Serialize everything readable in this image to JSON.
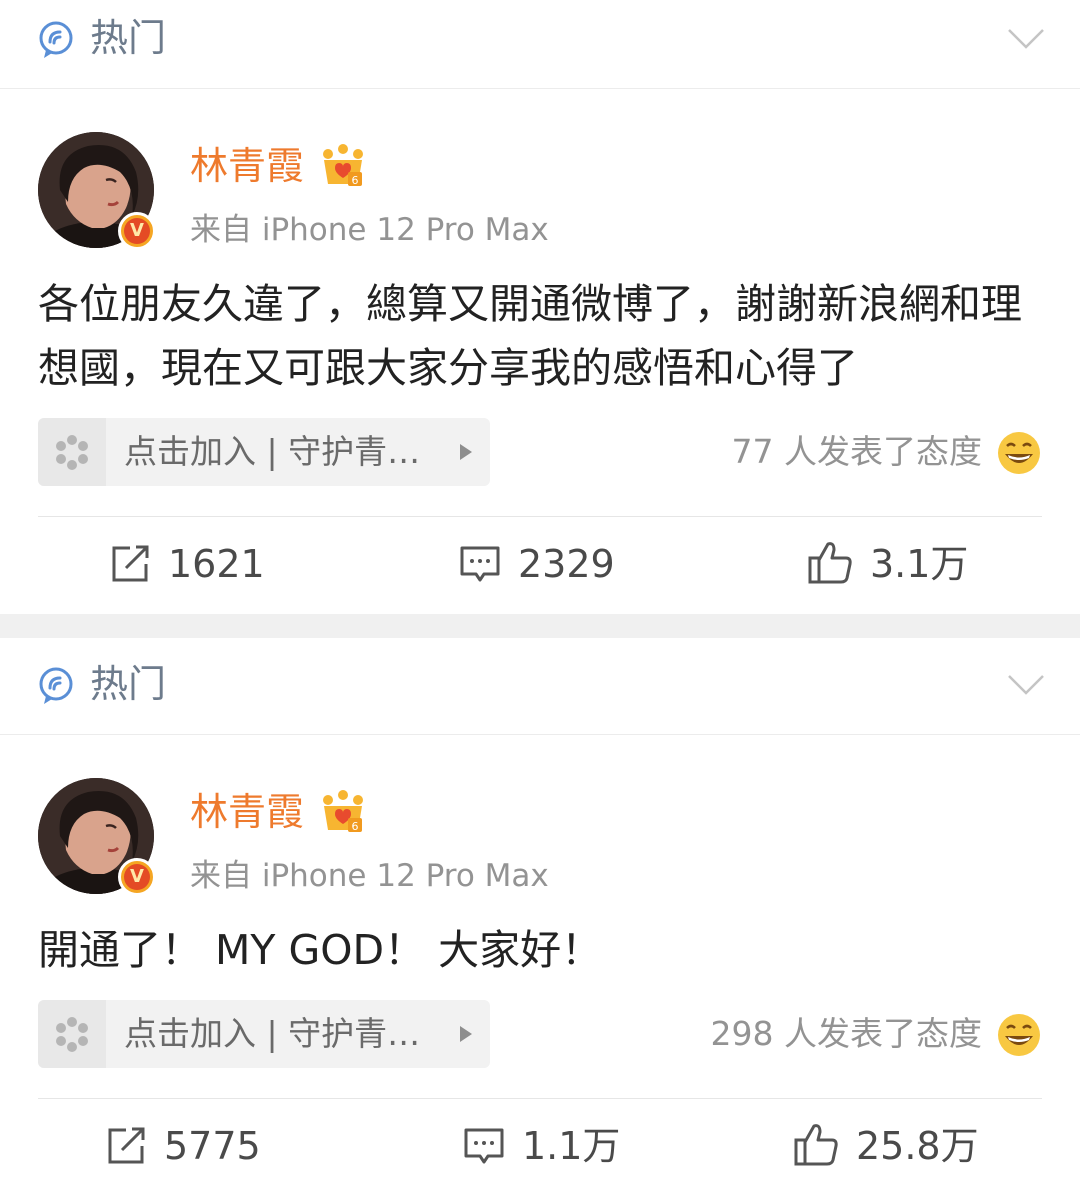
{
  "posts": [
    {
      "hot_label": "热门",
      "user_name": "林青霞",
      "verified_badge": "V",
      "source": "来自 iPhone 12 Pro Max",
      "text": "各位朋友久違了，總算又開通微博了，謝謝新浪網和理想國，現在又可跟大家分享我的感悟和心得了",
      "fan_club": "点击加入 | 守护青…",
      "reaction_text": "77 人发表了态度",
      "reposts": "1621",
      "comments": "2329",
      "likes": "3.1万"
    },
    {
      "hot_label": "热门",
      "user_name": "林青霞",
      "verified_badge": "V",
      "source": "来自 iPhone 12 Pro Max",
      "text": "開通了！ MY GOD！ 大家好！",
      "fan_club": "点击加入 | 守护青…",
      "reaction_text": "298 人发表了态度",
      "reposts": "5775",
      "comments": "1.1万",
      "likes": "25.8万"
    }
  ],
  "colors": {
    "accent_name": "#ee7a2d",
    "hot_label": "#6d7b8c",
    "secondary_text": "#939393",
    "separator": "#f0f0f0"
  },
  "icons": {
    "hot": "hot-topic-icon",
    "collapse": "chevron-down-icon",
    "member": "crown-member-icon",
    "fan_club": "fan-club-flower-icon",
    "reaction": "grin-emoji-icon",
    "repost": "repost-icon",
    "comment": "comment-icon",
    "like": "thumbs-up-icon"
  }
}
